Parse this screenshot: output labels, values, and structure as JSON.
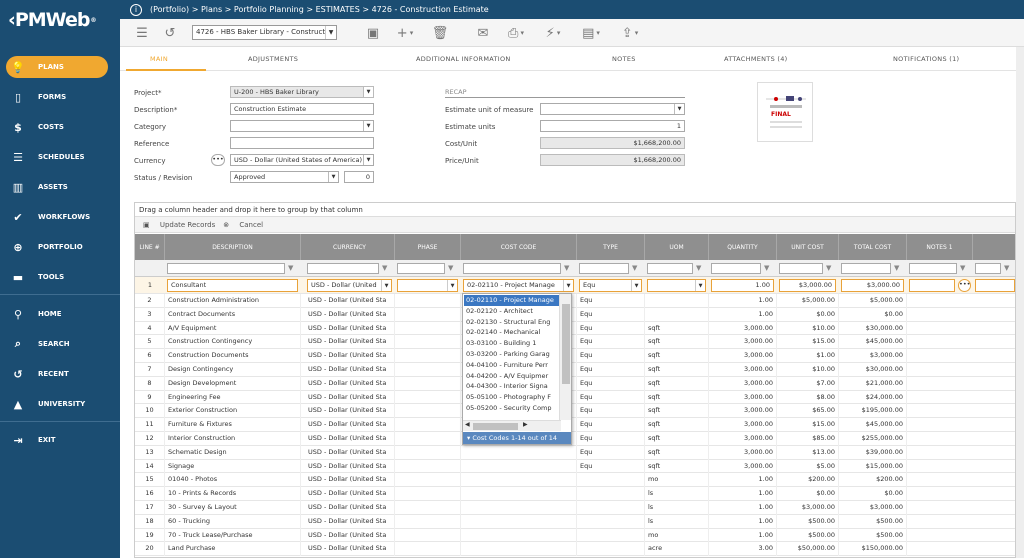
{
  "app": {
    "logo": "PMWeb",
    "logo_reg": "®",
    "back_glyph": "‹"
  },
  "sidebar": {
    "items": [
      {
        "label": "PLANS",
        "icon": "lightbulb-icon",
        "glyph": "💡",
        "active": true
      },
      {
        "label": "FORMS",
        "icon": "document-icon",
        "glyph": "▯"
      },
      {
        "label": "COSTS",
        "icon": "dollar-icon",
        "glyph": "$"
      },
      {
        "label": "SCHEDULES",
        "icon": "schedule-icon",
        "glyph": "☰"
      },
      {
        "label": "ASSETS",
        "icon": "building-icon",
        "glyph": "▥"
      },
      {
        "label": "WORKFLOWS",
        "icon": "check-icon",
        "glyph": "✔"
      },
      {
        "label": "PORTFOLIO",
        "icon": "globe-icon",
        "glyph": "⊕"
      },
      {
        "label": "TOOLS",
        "icon": "toolbox-icon",
        "glyph": "▬"
      },
      {
        "label": "HOME",
        "icon": "home-icon",
        "glyph": "⚲"
      },
      {
        "label": "SEARCH",
        "icon": "search-icon",
        "glyph": "⌕"
      },
      {
        "label": "RECENT",
        "icon": "history-icon",
        "glyph": "↺"
      },
      {
        "label": "UNIVERSITY",
        "icon": "graduation-cap-icon",
        "glyph": "▲"
      },
      {
        "label": "EXIT",
        "icon": "exit-icon",
        "glyph": "⇥"
      }
    ]
  },
  "topbar": {
    "breadcrumb": "(Portfolio) > Plans > Portfolio Planning > ESTIMATES > 4726 - Construction Estimate"
  },
  "toolbar": {
    "record": "4726 - HBS Baker Library - Construct"
  },
  "tabs": [
    "MAIN",
    "ADJUSTMENTS",
    "ADDITIONAL INFORMATION",
    "NOTES",
    "ATTACHMENTS (4)",
    "NOTIFICATIONS (1)"
  ],
  "form": {
    "project_label": "Project*",
    "project_value": "U-200 - HBS Baker Library",
    "description_label": "Description*",
    "description_value": "Construction Estimate",
    "category_label": "Category",
    "category_value": "",
    "reference_label": "Reference",
    "reference_value": "",
    "currency_label": "Currency",
    "currency_value": "USD - Dollar (United States of America)",
    "status_label": "Status / Revision",
    "status_value": "Approved",
    "revision_value": "0",
    "recap_label": "RECAP",
    "uom_label": "Estimate unit of measure",
    "uom_value": "",
    "units_label": "Estimate units",
    "units_value": "1",
    "cost_unit_label": "Cost/Unit",
    "cost_unit_value": "$1,668,200.00",
    "price_unit_label": "Price/Unit",
    "price_unit_value": "$1,668,200.00",
    "thumb_final": "FINAL"
  },
  "grid": {
    "group_hint": "Drag a column header and drop it here to group by that column",
    "update_label": "Update Records",
    "cancel_label": "Cancel",
    "columns": [
      "LINE #",
      "DESCRIPTION",
      "CURRENCY",
      "PHASE",
      "COST CODE",
      "TYPE",
      "UOM",
      "QUANTITY",
      "UNIT COST",
      "TOTAL COST",
      "NOTES 1"
    ],
    "rows": [
      [
        "1",
        "Consultant",
        "USD - Dollar (United",
        "",
        "02-02110 - Project Manage",
        "Equ",
        "",
        "1.00",
        "$3,000.00",
        "$3,000.00"
      ],
      [
        "2",
        "Construction Administration",
        "USD - Dollar (United Sta",
        "",
        "",
        "Equ",
        "",
        "1.00",
        "$5,000.00",
        "$5,000.00"
      ],
      [
        "3",
        "Contract Documents",
        "USD - Dollar (United Sta",
        "",
        "",
        "Equ",
        "",
        "1.00",
        "$0.00",
        "$0.00"
      ],
      [
        "4",
        "A/V Equipment",
        "USD - Dollar (United Sta",
        "",
        "",
        "Equ",
        "sqft",
        "3,000.00",
        "$10.00",
        "$30,000.00"
      ],
      [
        "5",
        "Construction Contingency",
        "USD - Dollar (United Sta",
        "",
        "",
        "Equ",
        "sqft",
        "3,000.00",
        "$15.00",
        "$45,000.00"
      ],
      [
        "6",
        "Construction Documents",
        "USD - Dollar (United Sta",
        "",
        "",
        "Equ",
        "sqft",
        "3,000.00",
        "$1.00",
        "$3,000.00"
      ],
      [
        "7",
        "Design Contingency",
        "USD - Dollar (United Sta",
        "",
        "",
        "Equ",
        "sqft",
        "3,000.00",
        "$10.00",
        "$30,000.00"
      ],
      [
        "8",
        "Design Development",
        "USD - Dollar (United Sta",
        "",
        "",
        "Equ",
        "sqft",
        "3,000.00",
        "$7.00",
        "$21,000.00"
      ],
      [
        "9",
        "Engineering Fee",
        "USD - Dollar (United Sta",
        "",
        "",
        "Equ",
        "sqft",
        "3,000.00",
        "$8.00",
        "$24,000.00"
      ],
      [
        "10",
        "Exterior Construction",
        "USD - Dollar (United Sta",
        "",
        "",
        "Equ",
        "sqft",
        "3,000.00",
        "$65.00",
        "$195,000.00"
      ],
      [
        "11",
        "Furniture & Fixtures",
        "USD - Dollar (United Sta",
        "",
        "",
        "Equ",
        "sqft",
        "3,000.00",
        "$15.00",
        "$45,000.00"
      ],
      [
        "12",
        "Interior Construction",
        "USD - Dollar (United Sta",
        "",
        "",
        "Equ",
        "sqft",
        "3,000.00",
        "$85.00",
        "$255,000.00"
      ],
      [
        "13",
        "Schematic Design",
        "USD - Dollar (United Sta",
        "",
        "",
        "Equ",
        "sqft",
        "3,000.00",
        "$13.00",
        "$39,000.00"
      ],
      [
        "14",
        "Signage",
        "USD - Dollar (United Sta",
        "",
        "",
        "Equ",
        "sqft",
        "3,000.00",
        "$5.00",
        "$15,000.00"
      ],
      [
        "15",
        "01040 - Photos",
        "USD - Dollar (United Sta",
        "",
        "",
        "",
        "mo",
        "1.00",
        "$200.00",
        "$200.00"
      ],
      [
        "16",
        "10 - Prints & Records",
        "USD - Dollar (United Sta",
        "",
        "",
        "",
        "ls",
        "1.00",
        "$0.00",
        "$0.00"
      ],
      [
        "17",
        "30 - Survey & Layout",
        "USD - Dollar (United Sta",
        "",
        "",
        "",
        "ls",
        "1.00",
        "$3,000.00",
        "$3,000.00"
      ],
      [
        "18",
        "60 - Trucking",
        "USD - Dollar (United Sta",
        "",
        "",
        "",
        "ls",
        "1.00",
        "$500.00",
        "$500.00"
      ],
      [
        "19",
        "70 - Truck Lease/Purchase",
        "USD - Dollar (United Sta",
        "",
        "",
        "",
        "mo",
        "1.00",
        "$500.00",
        "$500.00"
      ],
      [
        "20",
        "Land Purchase",
        "USD - Dollar (United Sta",
        "",
        "",
        "",
        "acre",
        "3.00",
        "$50,000.00",
        "$150,000.00"
      ]
    ]
  },
  "costcode_dropdown": {
    "options": [
      "02-02110 - Project Manage",
      "02-02120 - Architect",
      "02-02130 - Structural Eng",
      "02-02140 - Mechanical",
      "03-03100 - Building 1",
      "03-03200 - Parking Garag",
      "04-04100 - Furniture Perr",
      "04-04200 - A/V Equipmer",
      "04-04300 - Interior Signa",
      "05-05100 - Photography F",
      "05-05200 - Security Comp"
    ],
    "footer": "▾ Cost Codes 1-14 out of 14"
  },
  "colors": {
    "sidebar": "#1b4d72",
    "accent": "#f0a830",
    "grid_header": "#8f8f8f"
  }
}
